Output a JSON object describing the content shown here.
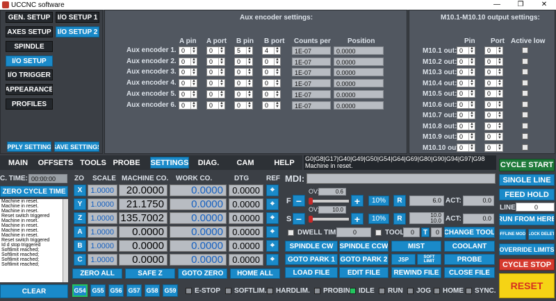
{
  "window": {
    "title": "UCCNC software",
    "min": "—",
    "max": "❐",
    "close": "✕"
  },
  "setup_nav": {
    "gen_setup": "GEN. SETUP",
    "io_setup_1": "I/O SETUP 1",
    "axes_setup": "AXES SETUP",
    "io_setup_2": "I/O SETUP 2",
    "spindle": "SPINDLE",
    "io_setup": "I/O SETUP",
    "io_trigger": "I/O TRIGGER",
    "appearance": "APPEARANCE",
    "profiles": "PROFILES",
    "apply": "APPLY SETTINGS",
    "save": "SAVE SETTINGS"
  },
  "aux": {
    "title": "Aux encoder settings:",
    "headers": [
      "A pin",
      "A port",
      "B pin",
      "B port",
      "Counts per",
      "Position"
    ],
    "rows": [
      {
        "label": "Aux encoder 1.",
        "a_pin": "0",
        "a_port": "0",
        "b_pin": "5",
        "b_port": "4",
        "counts": "1E-07",
        "position": "0.0000"
      },
      {
        "label": "Aux encoder 2.",
        "a_pin": "0",
        "a_port": "0",
        "b_pin": "0",
        "b_port": "0",
        "counts": "1E-07",
        "position": "0.0000"
      },
      {
        "label": "Aux encoder 3.",
        "a_pin": "0",
        "a_port": "0",
        "b_pin": "0",
        "b_port": "0",
        "counts": "1E-07",
        "position": "0.0000"
      },
      {
        "label": "Aux encoder 4.",
        "a_pin": "0",
        "a_port": "0",
        "b_pin": "0",
        "b_port": "0",
        "counts": "1E-07",
        "position": "0.0000"
      },
      {
        "label": "Aux encoder 5.",
        "a_pin": "0",
        "a_port": "0",
        "b_pin": "0",
        "b_port": "0",
        "counts": "1E-07",
        "position": "0.0000"
      },
      {
        "label": "Aux encoder 6.",
        "a_pin": "0",
        "a_port": "0",
        "b_pin": "0",
        "b_port": "0",
        "counts": "1E-07",
        "position": "0.0000"
      }
    ]
  },
  "m10": {
    "title": "M10.1-M10.10 output settings:",
    "headers": [
      "Pin",
      "Port",
      "Active low"
    ],
    "rows": [
      {
        "label": "M10.1 out:",
        "pin": "0",
        "port": "0"
      },
      {
        "label": "M10.2 out:",
        "pin": "0",
        "port": "0"
      },
      {
        "label": "M10.3 out:",
        "pin": "0",
        "port": "0"
      },
      {
        "label": "M10.4 out:",
        "pin": "0",
        "port": "0"
      },
      {
        "label": "M10.5 out:",
        "pin": "0",
        "port": "0"
      },
      {
        "label": "M10.6 out:",
        "pin": "0",
        "port": "0"
      },
      {
        "label": "M10.7 out:",
        "pin": "0",
        "port": "0"
      },
      {
        "label": "M10.8 out:",
        "pin": "0",
        "port": "0"
      },
      {
        "label": "M10.9 out:",
        "pin": "0",
        "port": "0"
      },
      {
        "label": "M10.10 out:",
        "pin": "0",
        "port": "0"
      }
    ]
  },
  "tabs": [
    "MAIN",
    "OFFSETS",
    "TOOLS",
    "PROBE",
    "SETTINGS",
    "DIAG.",
    "CAM",
    "HELP"
  ],
  "gcode_status": "G0|G8|G17|G40|G49|G50|G54|G64|G69|G80|G90|G94|G97|G98",
  "machine_status": "Machine in reset.",
  "cycle": {
    "label": "C. TIME:",
    "value": "00:00:00",
    "zero": "ZERO CYCLE TIME"
  },
  "log": [
    "Machine in reset.",
    "Machine in reset.",
    "Machine in reset.",
    "Reset switch triggered",
    "Machine in reset.",
    "Machine in reset.",
    "Machine in reset.",
    "Machine in reset.",
    "Reset switch triggered",
    "Id d stop triggered",
    "Softlimit reached;",
    "Softlimit reached;",
    "Softlimit reached;",
    "Softlimit reached;"
  ],
  "clear": "CLEAR",
  "dro": {
    "headers": [
      "ZO",
      "SCALE",
      "MACHINE CO.",
      "WORK CO.",
      "DTG",
      "REF"
    ],
    "axes": [
      {
        "axis": "X",
        "scale": "1.0000",
        "machine": "20.0000",
        "work": "0.0000",
        "dtg": "0.0000"
      },
      {
        "axis": "Y",
        "scale": "1.0000",
        "machine": "21.1750",
        "work": "0.0000",
        "dtg": "0.0000"
      },
      {
        "axis": "Z",
        "scale": "1.0000",
        "machine": "135.7002",
        "work": "0.0000",
        "dtg": "0.0000"
      },
      {
        "axis": "A",
        "scale": "1.0000",
        "machine": "0.0000",
        "work": "0.0000",
        "dtg": "0.0000"
      },
      {
        "axis": "B",
        "scale": "1.0000",
        "machine": "0.0000",
        "work": "0.0000",
        "dtg": "0.0000"
      },
      {
        "axis": "C",
        "scale": "1.0000",
        "machine": "0.0000",
        "work": "0.0000",
        "dtg": "0.0000"
      }
    ],
    "zero_all": "ZERO ALL",
    "safe_z": "SAFE Z",
    "goto_zero": "GOTO ZERO",
    "home_all": "HOME ALL"
  },
  "offsets": [
    "G54",
    "G55",
    "G56",
    "G57",
    "G58",
    "G59"
  ],
  "mdi": {
    "label": "MDI:"
  },
  "feed": {
    "f": "F",
    "minus": "−",
    "plus": "+",
    "ov_label": "OV:",
    "ov": "0.6",
    "pct": "10%",
    "r": "R",
    "r_val": "6.0",
    "act": "ACT:",
    "act_val": "0.0"
  },
  "spindle": {
    "s": "S",
    "minus": "−",
    "plus": "+",
    "ov_label": "OV:",
    "ov": "10.0",
    "pct": "10%",
    "r": "R",
    "r_top": "10.0",
    "r_val": "10.0",
    "act": "ACT:",
    "act_val": "0.0"
  },
  "dwell": {
    "label": "DWELL TIME:",
    "value": "0",
    "tool": "TOOL:",
    "tool_val": "0",
    "t": "T",
    "t_val": "0",
    "change": "CHANGE TOOL"
  },
  "actions": [
    "SPINDLE CW",
    "SPINDLE CCW",
    "MIST",
    "COOLANT",
    "GOTO PARK 1",
    "GOTO PARK 2",
    "JSP",
    "SOFT LIMIT",
    "PROBE",
    "LOAD FILE",
    "EDIT FILE",
    "REWIND FILE",
    "CLOSE FILE"
  ],
  "leds": [
    "E-STOP",
    "SOFTLIM.",
    "HARDLIM.",
    "PROBING",
    "IDLE",
    "RUN",
    "JOG",
    "HOME",
    "SYNC."
  ],
  "right": {
    "cycle_start": "CYCLE START",
    "single_line": "SINGLE LINE",
    "feed_hold": "FEED HOLD",
    "line_label": "LINE:",
    "line_val": "0",
    "run_from_here": "RUN FROM HERE",
    "offline": "OFFLINE MODE",
    "block_delete": "BLOCK DELETE",
    "override": "OVERRIDE LIMITS",
    "cycle_stop": "CYCLE STOP",
    "reset": "RESET"
  },
  "colors": {
    "accent": "#1a8ac9",
    "green": "#22c55e",
    "red": "#d63b2f",
    "yellow": "#f5d315"
  }
}
